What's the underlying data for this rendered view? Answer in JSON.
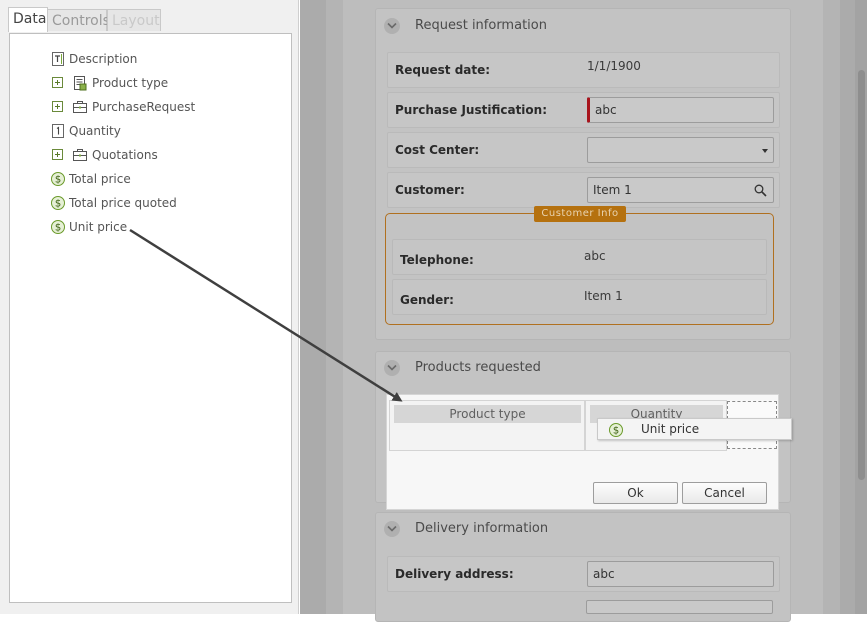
{
  "tabs": [
    {
      "label": "Data",
      "active": true
    },
    {
      "label": "Controls",
      "active": false
    },
    {
      "label": "Layout",
      "active": false
    }
  ],
  "tree": [
    {
      "label": "Description",
      "icon": "text-field-icon",
      "expandable": false
    },
    {
      "label": "Product type",
      "icon": "list-document-icon",
      "expandable": true
    },
    {
      "label": "PurchaseRequest",
      "icon": "briefcase-icon",
      "expandable": true
    },
    {
      "label": "Quantity",
      "icon": "number-field-icon",
      "expandable": false
    },
    {
      "label": "Quotations",
      "icon": "briefcase-icon",
      "expandable": true
    },
    {
      "label": "Total price",
      "icon": "currency-icon",
      "expandable": false
    },
    {
      "label": "Total price quoted",
      "icon": "currency-icon",
      "expandable": false
    },
    {
      "label": "Unit price",
      "icon": "currency-icon",
      "expandable": false
    }
  ],
  "form": {
    "sections": [
      {
        "title": "Request information"
      },
      {
        "title": "Products requested"
      },
      {
        "title": "Delivery information"
      }
    ],
    "request_date": {
      "label": "Request date:",
      "value": "1/1/1900"
    },
    "purchase_justification": {
      "label": "Purchase Justification:",
      "value": "abc"
    },
    "cost_center": {
      "label": "Cost Center:",
      "value": ""
    },
    "customer": {
      "label": "Customer:",
      "value": "Item 1"
    },
    "customer_info": {
      "caption": "Customer Info",
      "telephone": {
        "label": "Telephone:",
        "value": "abc"
      },
      "gender": {
        "label": "Gender:",
        "value": "Item 1"
      }
    },
    "delivery_address": {
      "label": "Delivery address:",
      "value": "abc"
    }
  },
  "grid_dialog": {
    "columns": [
      "Product type",
      "Quantity"
    ],
    "dragging_item": "Unit price",
    "ok_label": "Ok",
    "cancel_label": "Cancel"
  },
  "colors": {
    "required_marker": "#a8141c",
    "group_border": "#b07020",
    "group_caption_bg": "#b5710f",
    "currency_icon": "#7aa83a",
    "drag_arrow": "#3f3f3f"
  }
}
